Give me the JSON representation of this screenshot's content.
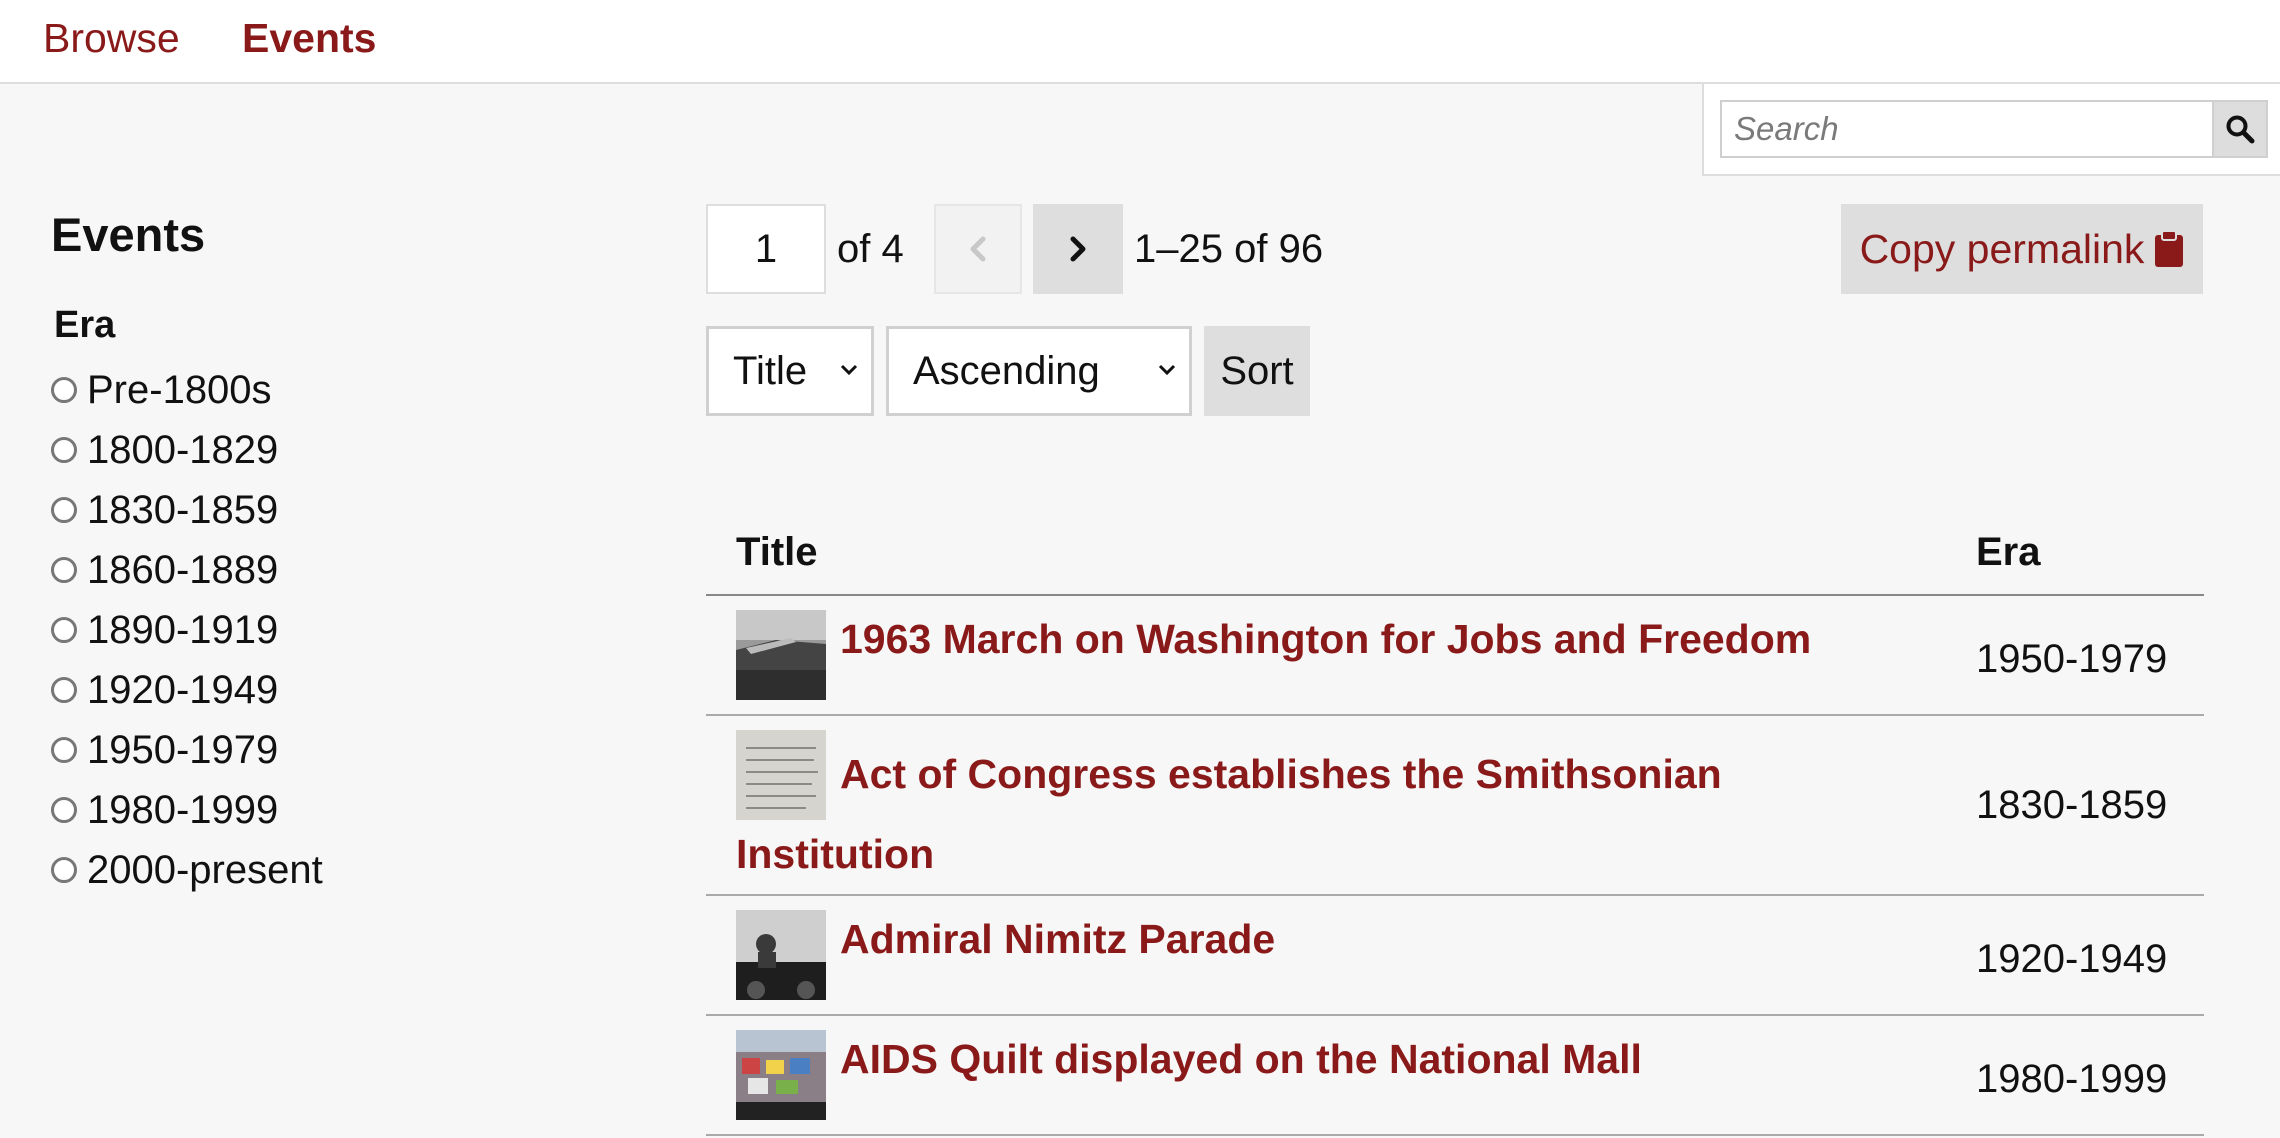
{
  "nav": {
    "items": [
      {
        "label": "Browse"
      },
      {
        "label": "Events"
      }
    ]
  },
  "search": {
    "placeholder": "Search",
    "icon": "search-icon"
  },
  "sidebar": {
    "title": "Events",
    "facet": {
      "heading": "Era",
      "options": [
        "Pre-1800s",
        "1800-1829",
        "1830-1859",
        "1860-1889",
        "1890-1919",
        "1920-1949",
        "1950-1979",
        "1980-1999",
        "2000-present"
      ]
    }
  },
  "pagination": {
    "current_page": "1",
    "of_pages": "of 4",
    "range": "1–25 of 96",
    "prev_icon": "chevron-left-icon",
    "next_icon": "chevron-right-icon"
  },
  "permalink": {
    "label": "Copy permalink",
    "icon": "clipboard-icon"
  },
  "sort": {
    "field": "Title",
    "order": "Ascending",
    "button": "Sort"
  },
  "table": {
    "headers": {
      "title": "Title",
      "era": "Era"
    },
    "rows": [
      {
        "title": "1963 March on Washington for Jobs and Freedom",
        "era": "1950-1979"
      },
      {
        "title": "Act of Congress establishes the Smithsonian Institution",
        "era": "1830-1859"
      },
      {
        "title": "Admiral Nimitz Parade",
        "era": "1920-1949"
      },
      {
        "title": "AIDS Quilt displayed on the National Mall",
        "era": "1980-1999"
      }
    ]
  },
  "colors": {
    "accent": "#8a1a1a",
    "background": "#f7f7f7",
    "button": "#dedede"
  }
}
